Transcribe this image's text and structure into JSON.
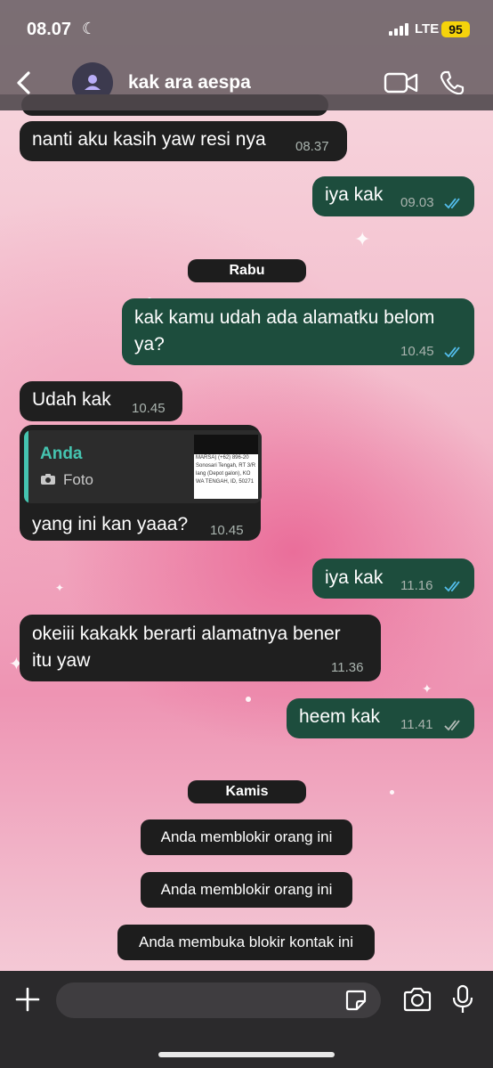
{
  "status_bar": {
    "time": "08.07",
    "network": "LTE",
    "battery": "95"
  },
  "header": {
    "contact_name": "kak ara aespa"
  },
  "messages": [
    {
      "direction": "in",
      "text": "nanti aku kasih yaw resi nya",
      "time": "08.37"
    },
    {
      "direction": "out",
      "text": "iya kak",
      "time": "09.03"
    },
    {
      "direction": "out",
      "text_line1": "kak kamu udah ada alamatku belom",
      "text_line2": "ya?",
      "time": "10.45"
    },
    {
      "direction": "in",
      "text": "Udah kak",
      "time": "10.45"
    },
    {
      "direction": "in",
      "quote_author": "Anda",
      "quote_type": "Foto",
      "quote_thumb_lines": [
        "MARSA)  (+62) 896-20",
        "Sonosari Tengah, RT 3/R",
        "lang (Depot galon), KO",
        "WA TENGAH, ID, 50271"
      ],
      "text": "yang ini kan yaaa?",
      "time": "10.45"
    },
    {
      "direction": "out",
      "text": "iya kak",
      "time": "11.16"
    },
    {
      "direction": "in",
      "text_line1": "okeiii kakakk berarti alamatnya bener",
      "text_line2": "itu yaw",
      "time": "11.36"
    },
    {
      "direction": "out",
      "text": "heem kak",
      "time": "11.41"
    }
  ],
  "date_separators": {
    "wed": "Rabu",
    "thu": "Kamis"
  },
  "system_messages": [
    "Anda memblokir orang ini",
    "Anda memblokir orang ini",
    "Anda membuka blokir kontak ini"
  ],
  "composer": {
    "placeholder": ""
  },
  "colors": {
    "incoming_bubble": "#1f1f1f",
    "outgoing_bubble": "#1d4d3d",
    "read_ticks": "#53bdeb",
    "quote_accent": "#45c4b0"
  }
}
